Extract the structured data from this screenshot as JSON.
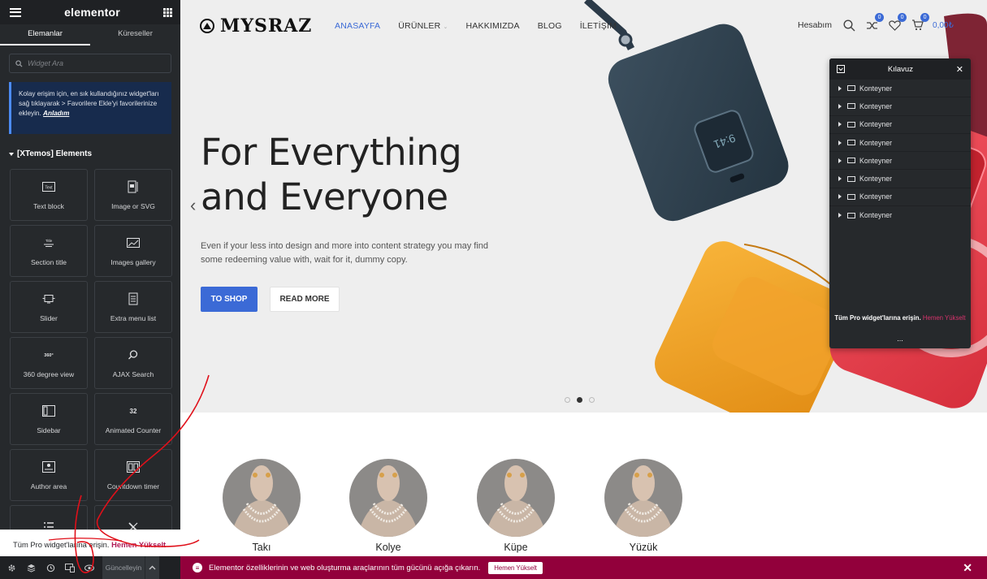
{
  "editor": {
    "brand": "elementor",
    "tabs": [
      "Elemanlar",
      "Küreseller"
    ],
    "search_placeholder": "Widget Ara",
    "notice_text": "Kolay erişim için, en sık kullandığınız widget'ları sağ tıklayarak > Favorilere Ekle'yi favorilerinize ekleyin.",
    "notice_link": "Anladım",
    "category": "[XTemos] Elements",
    "widgets": [
      {
        "label": "Text block",
        "icon": "text-block-icon"
      },
      {
        "label": "Image or SVG",
        "icon": "image-icon"
      },
      {
        "label": "Section title",
        "icon": "section-title-icon"
      },
      {
        "label": "Images gallery",
        "icon": "gallery-icon"
      },
      {
        "label": "Slider",
        "icon": "slider-icon"
      },
      {
        "label": "Extra menu list",
        "icon": "menu-list-icon"
      },
      {
        "label": "360 degree view",
        "icon": "360-view-icon"
      },
      {
        "label": "AJAX Search",
        "icon": "search-icon"
      },
      {
        "label": "Sidebar",
        "icon": "sidebar-icon"
      },
      {
        "label": "Animated Counter",
        "icon": "counter-icon"
      },
      {
        "label": "Author area",
        "icon": "author-icon"
      },
      {
        "label": "Countdown timer",
        "icon": "countdown-icon"
      },
      {
        "label": "",
        "icon": "list-icon"
      },
      {
        "label": "",
        "icon": "x-twitter-icon"
      }
    ],
    "pro_text": "Tüm Pro widget'larına erişin.",
    "pro_link": "Hemen Yükselt",
    "footer_update": "Güncelleyin"
  },
  "site": {
    "logo": "MYSRAZ",
    "menu": [
      "ANASAYFA",
      "ÜRÜNLER",
      "HAKKIMIZDA",
      "BLOG",
      "İLETİŞİM"
    ],
    "account": "Hesabım",
    "compare_count": "0",
    "wishlist_count": "0",
    "cart_count": "0",
    "cart_total": "0,00₺",
    "hero_line1": "For Everything",
    "hero_line2": "and Everyone",
    "hero_text": "Even if your less into design and more into content strategy you may find some redeeming value with, wait for it, dummy copy.",
    "btn_shop": "TO SHOP",
    "btn_more": "READ MORE",
    "phone_time": "9:41",
    "categories": [
      "Takı",
      "Kolye",
      "Küpe",
      "Yüzük"
    ]
  },
  "navigator": {
    "title": "Kılavuz",
    "items": [
      "Konteyner",
      "Konteyner",
      "Konteyner",
      "Konteyner",
      "Konteyner",
      "Konteyner",
      "Konteyner",
      "Konteyner"
    ],
    "pro_text": "Tüm Pro widget'larına erişin.",
    "pro_link": "Hemen Yükselt",
    "more": "..."
  },
  "promo": {
    "message": "Elementor özelliklerinin ve web oluşturma araçlarının tüm gücünü açığa çıkarın.",
    "button": "Hemen Yükselt"
  },
  "colors": {
    "panel_bg": "#26292c",
    "accent_blue": "#3b6ad6",
    "promo_bg": "#92003b",
    "annotation_red": "#e0101a"
  }
}
